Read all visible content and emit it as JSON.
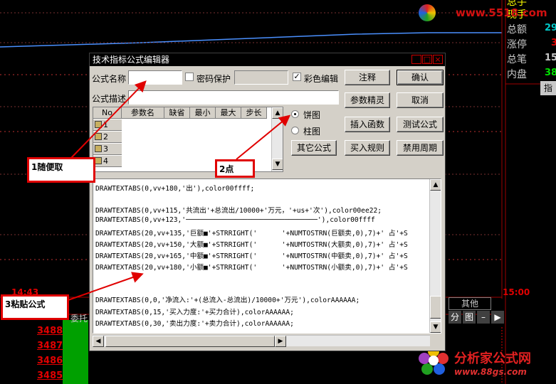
{
  "background": {
    "right_panel": [
      {
        "label": "总手",
        "value": "",
        "color": "#ffff00"
      },
      {
        "label": "现手",
        "value": "",
        "color": "#ffff00"
      },
      {
        "label": "总额",
        "value": "29",
        "color": "#00c8c8"
      },
      {
        "label": "涨停",
        "value": "3",
        "color": "#e00000"
      },
      {
        "label": "总笔",
        "value": "15",
        "color": "#c8c8c8"
      },
      {
        "label": "内盘",
        "value": "38",
        "color": "#00e000"
      }
    ],
    "right_panel_extra": "指",
    "time_left": "14:43",
    "time_right": "15:00",
    "order_label": "委托",
    "prices": [
      "3488",
      "3487",
      "3486",
      "3485"
    ],
    "others_label": "其他",
    "others_tabs": [
      "分",
      "图",
      "–",
      "▶"
    ],
    "watermark_top": "www.5518.com",
    "watermark_bottom_title": "分析家公式网",
    "watermark_bottom_url": "www.88gs.com"
  },
  "dialog": {
    "title": "技术指标公式编辑器",
    "name_label": "公式名称",
    "name_value": "",
    "password_label": "密码保护",
    "password_checked": false,
    "color_edit_label": "彩色编辑",
    "color_edit_checked": true,
    "desc_label": "公式描述",
    "desc_value": "",
    "buttons": {
      "comment": "注释",
      "ok": "确认",
      "param_tune": "参数精灵",
      "cancel": "取消",
      "insert_func": "插入函数",
      "test": "测试公式",
      "other": "其它公式",
      "buy_rule": "买入规则",
      "disable_period": "禁用周期"
    },
    "radio": {
      "pie": "饼图",
      "bar": "柱图",
      "selected": "饼图"
    },
    "grid_headers": [
      "No",
      "参数名",
      "缺省",
      "最小",
      "最大",
      "步长"
    ],
    "grid_rows": [
      "1",
      "2",
      "3",
      "4"
    ],
    "code_lines": [
      "DRAWTEXTABS(0,vv+180,'出'),color00ffff;",
      "",
      "DRAWTEXTABS(0,vv+115,'共流出'+总流出/10000+'万元，'+us+'次'),color00ee22;",
      "DRAWTEXTABS(0,vv+123,'────────────────────────────────'),color00ffff",
      "DRAWTEXTABS(20,vv+135,'巨额■'+STRRIGHT('      '+NUMTOSTRN(巨额卖,0),7)+' 占'+S",
      "DRAWTEXTABS(20,vv+150,'大额■'+STRRIGHT('      '+NUMTOSTRN(大额卖,0),7)+' 占'+S",
      "DRAWTEXTABS(20,vv+165,'中额■'+STRRIGHT('      '+NUMTOSTRN(中额卖,0),7)+' 占'+S",
      "DRAWTEXTABS(20,vv+180,'小额■'+STRRIGHT('      '+NUMTOSTRN(小额卖,0),7)+' 占'+S",
      "",
      "",
      "DRAWTEXTABS(0,0,'净流入:'+(总流入-总流出)/10000+'万元'),colorAAAAAA;",
      "DRAWTEXTABS(0,15,'买入力度:'+买力合计),colorAAAAAA;",
      "DRAWTEXTABS(0,30,'卖出力度:'+卖力合计),colorAAAAAA;"
    ]
  },
  "annotations": {
    "step1": "1随便取",
    "step2": "2点",
    "step3": "3粘贴公式"
  }
}
